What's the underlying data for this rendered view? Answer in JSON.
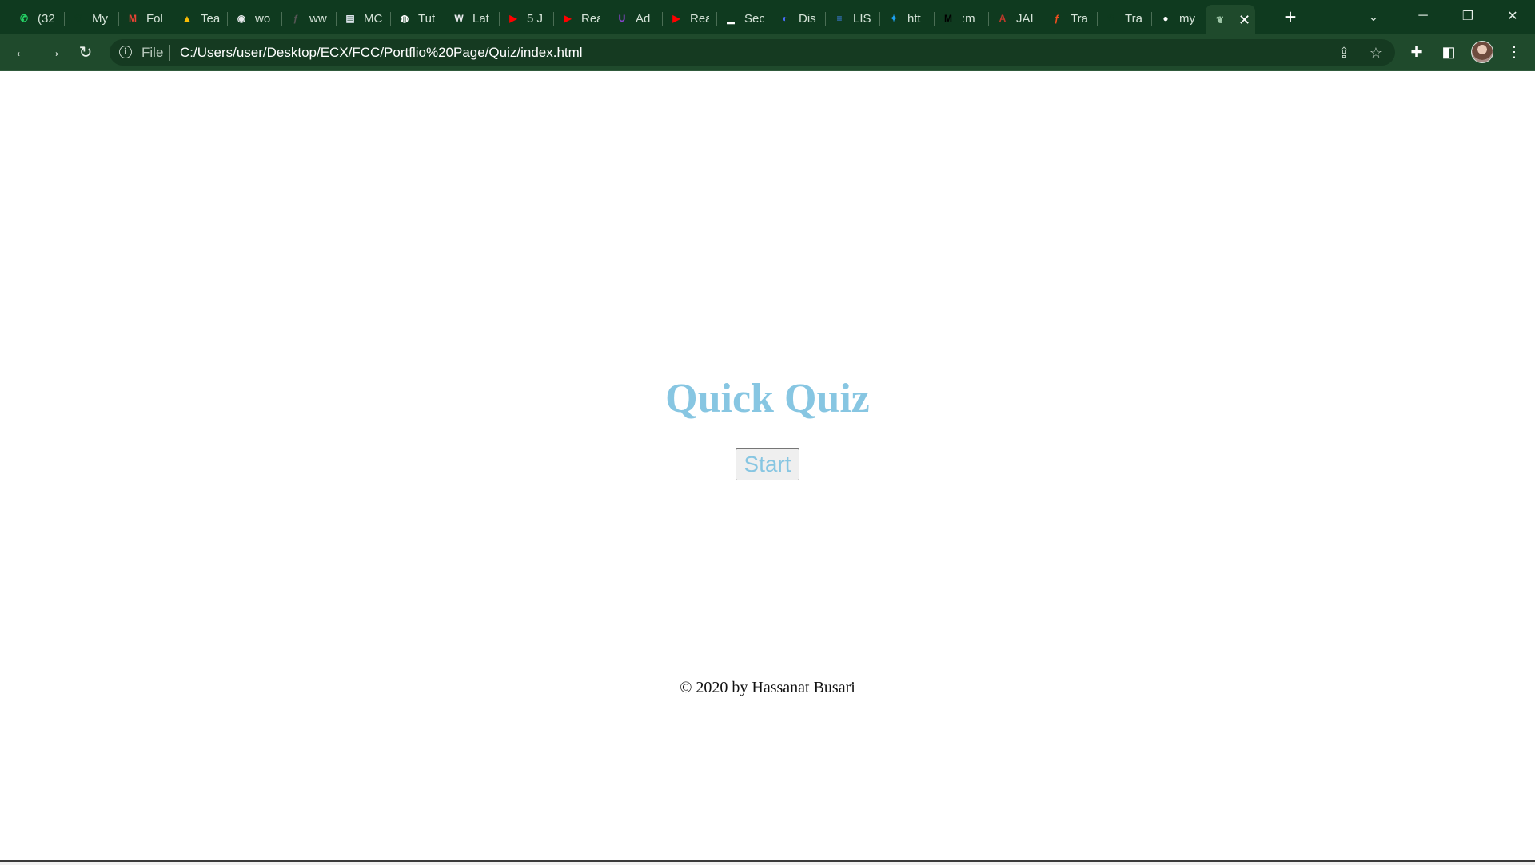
{
  "browser": {
    "tabs": [
      {
        "title": "(32",
        "icon": "whatsapp-icon",
        "color": "#25d366",
        "glyph": "✆"
      },
      {
        "title": "My",
        "icon": "leaf-icon",
        "color": "#0f3a1f",
        "glyph": "❦"
      },
      {
        "title": "Fol",
        "icon": "gmail-icon",
        "color": "#ea4335",
        "glyph": "M"
      },
      {
        "title": "Tea",
        "icon": "google-drive-icon",
        "color": "#fbbc04",
        "glyph": "▲"
      },
      {
        "title": "wo",
        "icon": "avatar-icon",
        "color": "#e8eaed",
        "glyph": "◉"
      },
      {
        "title": "ww",
        "icon": "figma-icon",
        "color": "#555555",
        "glyph": "ƒ"
      },
      {
        "title": "MC",
        "icon": "document-icon",
        "color": "#dfe6ee",
        "glyph": "▤"
      },
      {
        "title": "Tut",
        "icon": "globe-icon",
        "color": "#ffffff",
        "glyph": "◍"
      },
      {
        "title": "Lat",
        "icon": "wordpress-icon",
        "color": "#e8eaed",
        "glyph": "W"
      },
      {
        "title": "5 J",
        "icon": "youtube-icon",
        "color": "#ff0000",
        "glyph": "▶"
      },
      {
        "title": "Rea",
        "icon": "youtube-icon",
        "color": "#ff0000",
        "glyph": "▶"
      },
      {
        "title": "Ad",
        "icon": "udemy-icon",
        "color": "#8e44d6",
        "glyph": "U"
      },
      {
        "title": "Rea",
        "icon": "youtube-icon",
        "color": "#ff0000",
        "glyph": "▶"
      },
      {
        "title": "Sec",
        "icon": "bars-icon",
        "color": "#ffffff",
        "glyph": "▁"
      },
      {
        "title": "Dis",
        "icon": "circle-logo-icon",
        "color": "#4a6cf7",
        "glyph": "◐"
      },
      {
        "title": "LIS",
        "icon": "google-docs-icon",
        "color": "#4285f4",
        "glyph": "≡"
      },
      {
        "title": "htt",
        "icon": "twitter-icon",
        "color": "#1da1f2",
        "glyph": "✦"
      },
      {
        "title": ":m",
        "icon": "medium-icon",
        "color": "#000000",
        "glyph": "M"
      },
      {
        "title": "JAI",
        "icon": "font-icon",
        "color": "#c0392b",
        "glyph": "A"
      },
      {
        "title": "Tra",
        "icon": "figma-icon",
        "color": "#f24e1e",
        "glyph": "ƒ"
      },
      {
        "title": "Tra",
        "icon": "leaf-icon",
        "color": "#0f3a1f",
        "glyph": "❦"
      },
      {
        "title": "my",
        "icon": "github-icon",
        "color": "#ffffff",
        "glyph": "●"
      }
    ],
    "active_tab": {
      "icon": "leaf-icon",
      "color": "#1f4a2c",
      "glyph": "❦",
      "close": "✕"
    },
    "new_tab": "+",
    "tab_search": "⌄",
    "window": {
      "minimize": "─",
      "restore": "❐",
      "close": "✕"
    },
    "nav": {
      "back": "←",
      "forward": "→",
      "reload": "↻"
    },
    "omnibox": {
      "info": "i",
      "scheme": "File",
      "url": "C:/Users/user/Desktop/ECX/FCC/Portflio%20Page/Quiz/index.html"
    },
    "toolbar_icons": {
      "share": "⇪",
      "bookmark": "☆",
      "extensions": "✚",
      "sidepanel": "◧",
      "menu": "⋮"
    }
  },
  "page": {
    "title": "Quick Quiz",
    "start_label": "Start",
    "footer": "© 2020 by Hassanat Busari",
    "accent_color": "#87c6e2"
  }
}
